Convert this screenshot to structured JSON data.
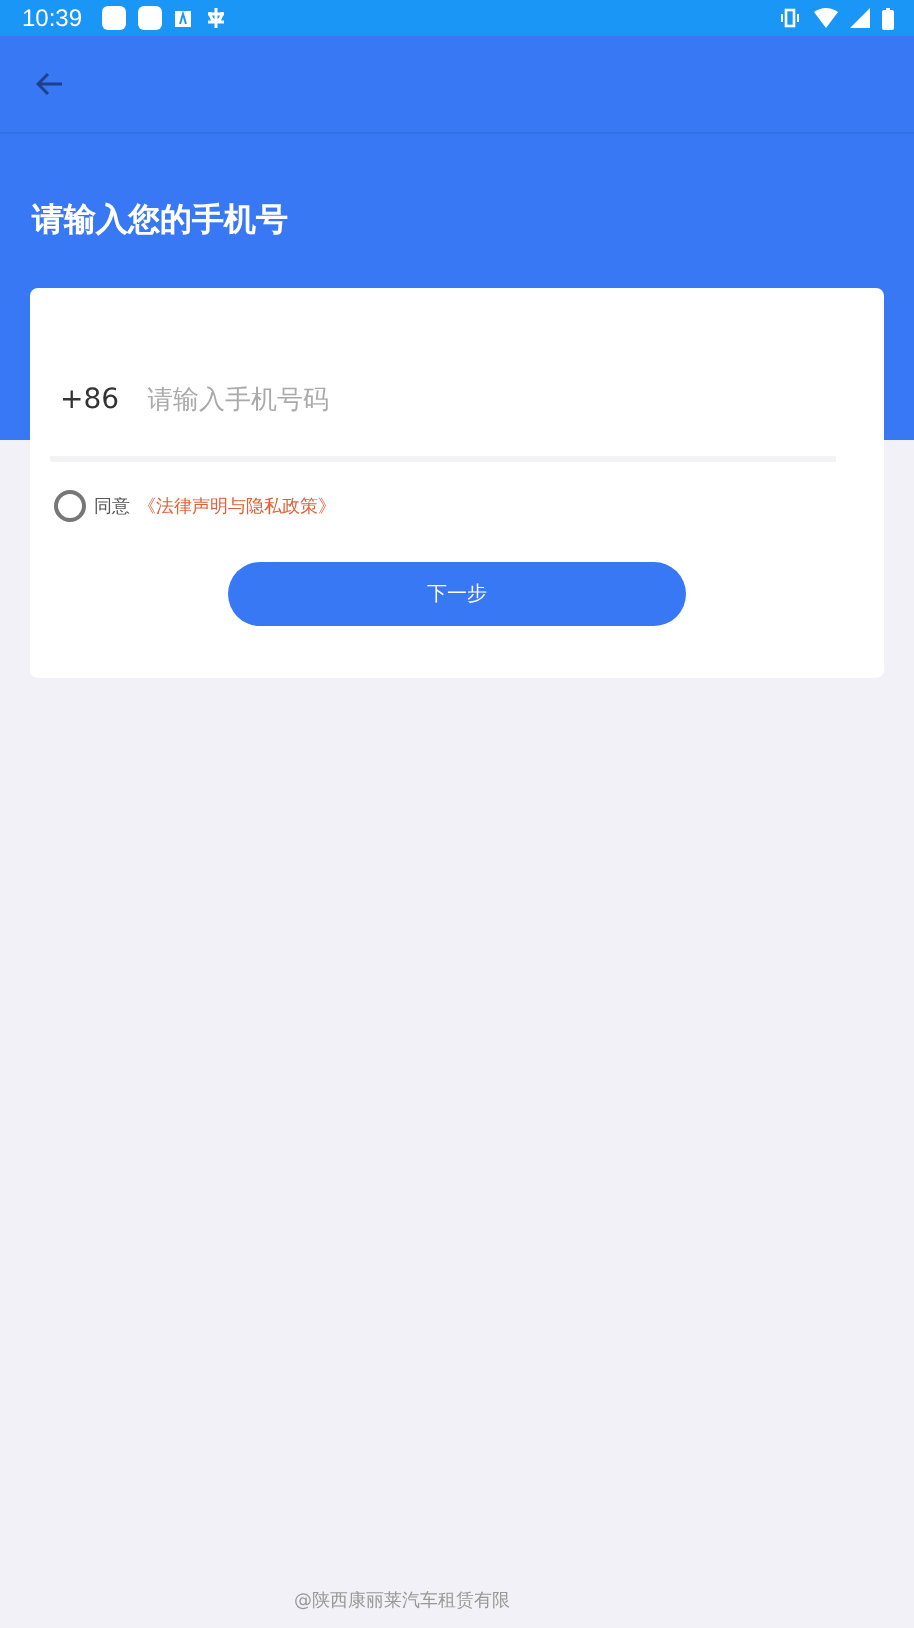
{
  "status_bar": {
    "time": "10:39"
  },
  "header": {
    "title": "请输入您的手机号"
  },
  "phone_field": {
    "country_code": "+86",
    "placeholder": "请输入手机号码"
  },
  "agreement": {
    "checked": false,
    "prefix": "同意",
    "link": "《法律声明与隐私政策》"
  },
  "next_button": {
    "label": "下一步"
  },
  "footer": {
    "text": "@陕西康丽莱汽车租赁有限"
  }
}
